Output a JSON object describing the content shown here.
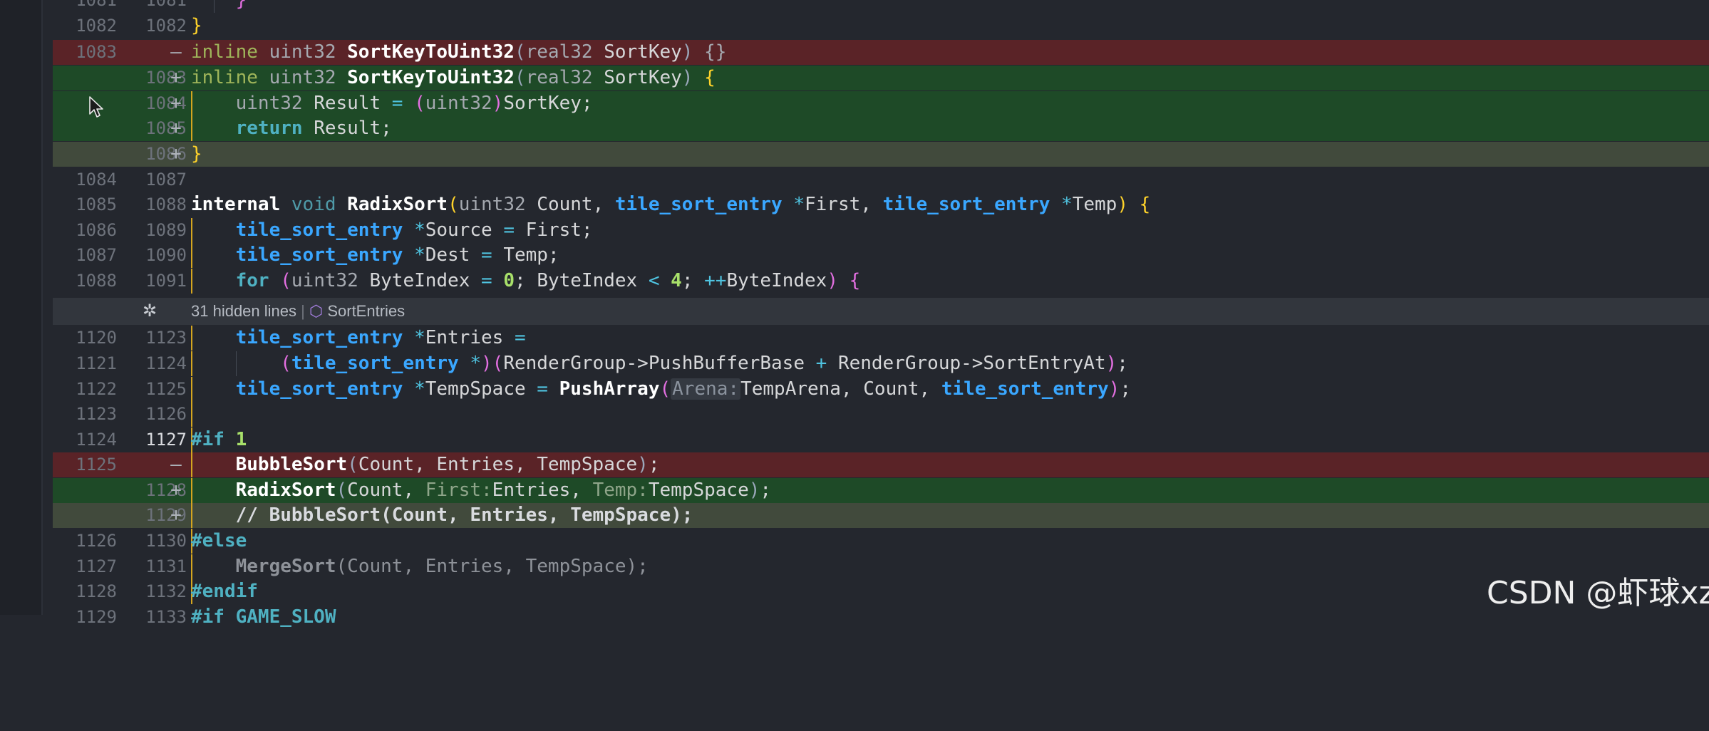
{
  "hidden": {
    "fold_count": "31 hidden lines",
    "fold_sep": "|",
    "symbol": "SortEntries",
    "expand_icon": "✲",
    "symbol_icon": "⬡"
  },
  "watermark": "CSDN @虾球xz",
  "lines": {
    "l1": {
      "old": "1081",
      "new": "1081"
    },
    "l2": {
      "old": "1082",
      "new": "1082"
    },
    "l3": {
      "old": "1083",
      "new": "",
      "mark": "—"
    },
    "l4": {
      "old": "",
      "new": "1083",
      "mark": "+"
    },
    "l5": {
      "old": "",
      "new": "1084",
      "mark": "+"
    },
    "l6": {
      "old": "",
      "new": "1085",
      "mark": "+"
    },
    "l7": {
      "old": "",
      "new": "1086",
      "mark": "+"
    },
    "l8": {
      "old": "1084",
      "new": "1087"
    },
    "l9": {
      "old": "1085",
      "new": "1088"
    },
    "l10": {
      "old": "1086",
      "new": "1089"
    },
    "l11": {
      "old": "1087",
      "new": "1090"
    },
    "l12": {
      "old": "1088",
      "new": "1091"
    },
    "l13": {
      "old": "1120",
      "new": "1123"
    },
    "l14": {
      "old": "1121",
      "new": "1124"
    },
    "l15": {
      "old": "1122",
      "new": "1125"
    },
    "l16": {
      "old": "1123",
      "new": "1126"
    },
    "l17": {
      "old": "1124",
      "new": "1127"
    },
    "l18": {
      "old": "1125",
      "new": "",
      "mark": "—"
    },
    "l19": {
      "old": "",
      "new": "1128",
      "mark": "+"
    },
    "l20": {
      "old": "",
      "new": "1129",
      "mark": "+"
    },
    "l21": {
      "old": "1126",
      "new": "1130"
    },
    "l22": {
      "old": "1127",
      "new": "1131"
    },
    "l23": {
      "old": "1128",
      "new": "1132"
    },
    "l24": {
      "old": "1129",
      "new": "1133"
    }
  },
  "code": {
    "c1_brace": "}",
    "c2_brace": "}",
    "c3": {
      "kw": "inline",
      "type": "uint32",
      "fn": "SortKeyToUint32",
      "open": "(",
      "ptype": "real32",
      "param": "SortKey",
      "close": ")",
      "body": "{}"
    },
    "c4": {
      "kw": "inline",
      "type": "uint32",
      "fn": "SortKeyToUint32",
      "open": "(",
      "ptype": "real32",
      "param": "SortKey",
      "close": ")",
      "brace": "{"
    },
    "c5": {
      "type": "uint32",
      "var": "Result",
      "eq": "=",
      "open": "(",
      "cast": "uint32",
      "close": ")",
      "rest": "SortKey;"
    },
    "c6": {
      "kw": "return",
      "rest": "Result;"
    },
    "c7_brace": "}",
    "c9": {
      "kw": "internal",
      "type": "void",
      "fn": "RadixSort",
      "open": "(",
      "t1": "uint32",
      "p1": "Count,",
      "t2": "tile_sort_entry",
      "star2": "*",
      "p2": "First,",
      "t3": "tile_sort_entry",
      "star3": "*",
      "p3": "Temp",
      "close": ")",
      "brace": "{"
    },
    "c10": {
      "type": "tile_sort_entry",
      "star": "*",
      "var": "Source",
      "eq": "=",
      "rest": "First;"
    },
    "c11": {
      "type": "tile_sort_entry",
      "star": "*",
      "var": "Dest",
      "eq": "=",
      "rest": "Temp;"
    },
    "c12": {
      "kw": "for",
      "open": "(",
      "type": "uint32",
      "var": "ByteIndex",
      "eq": "=",
      "zero": "0",
      "semi1": ";",
      "var2": "ByteIndex",
      "lt": "<",
      "four": "4",
      "semi2": ";",
      "inc": "++",
      "var3": "ByteIndex",
      "close": ")",
      "brace": "{"
    },
    "c13": {
      "type": "tile_sort_entry",
      "star": "*",
      "var": "Entries",
      "eq": "="
    },
    "c14": {
      "open": "(",
      "type": "tile_sort_entry",
      "star": "*",
      "close": ")",
      "open2": "(",
      "a": "RenderGroup->PushBufferBase",
      "plus": "+",
      "b": "RenderGroup->SortEntryAt",
      "close2": ")",
      "semi": ";"
    },
    "c15": {
      "type": "tile_sort_entry",
      "star": "*",
      "var": "TempSpace",
      "eq": "=",
      "fn": "PushArray",
      "open": "(",
      "hint": "Arena:",
      "a1": "TempArena,",
      "a2": "Count,",
      "t": "tile_sort_entry",
      "close": ")",
      "semi": ";"
    },
    "c17": {
      "pp": "#if",
      "one": "1"
    },
    "c18": {
      "fn": "BubbleSort",
      "open": "(",
      "args": "Count, Entries, TempSpace",
      "close": ")",
      "semi": ";"
    },
    "c19": {
      "fn": "RadixSort",
      "open": "(",
      "a1": "Count,",
      "h2": "First:",
      "a2": "Entries,",
      "h3": "Temp:",
      "a3": "TempSpace",
      "close": ")",
      "semi": ";"
    },
    "c20": "// BubbleSort(Count, Entries, TempSpace);",
    "c21": "#else",
    "c22": {
      "fn": "MergeSort",
      "open": "(",
      "args": "Count, Entries, TempSpace",
      "close": ")",
      "semi": ";"
    },
    "c23": "#endif",
    "c24": "#if GAME_SLOW"
  },
  "colors": {
    "background": "#24272e",
    "deleted_line": "#5a2327",
    "added_line": "#1e4a27",
    "modified_line": "#414a3c",
    "keyword": "#9fb55a",
    "type": "#3aa7ff",
    "function": "#ffffff",
    "bracket": "#ffd32a",
    "operator": "#4fc4e1"
  }
}
